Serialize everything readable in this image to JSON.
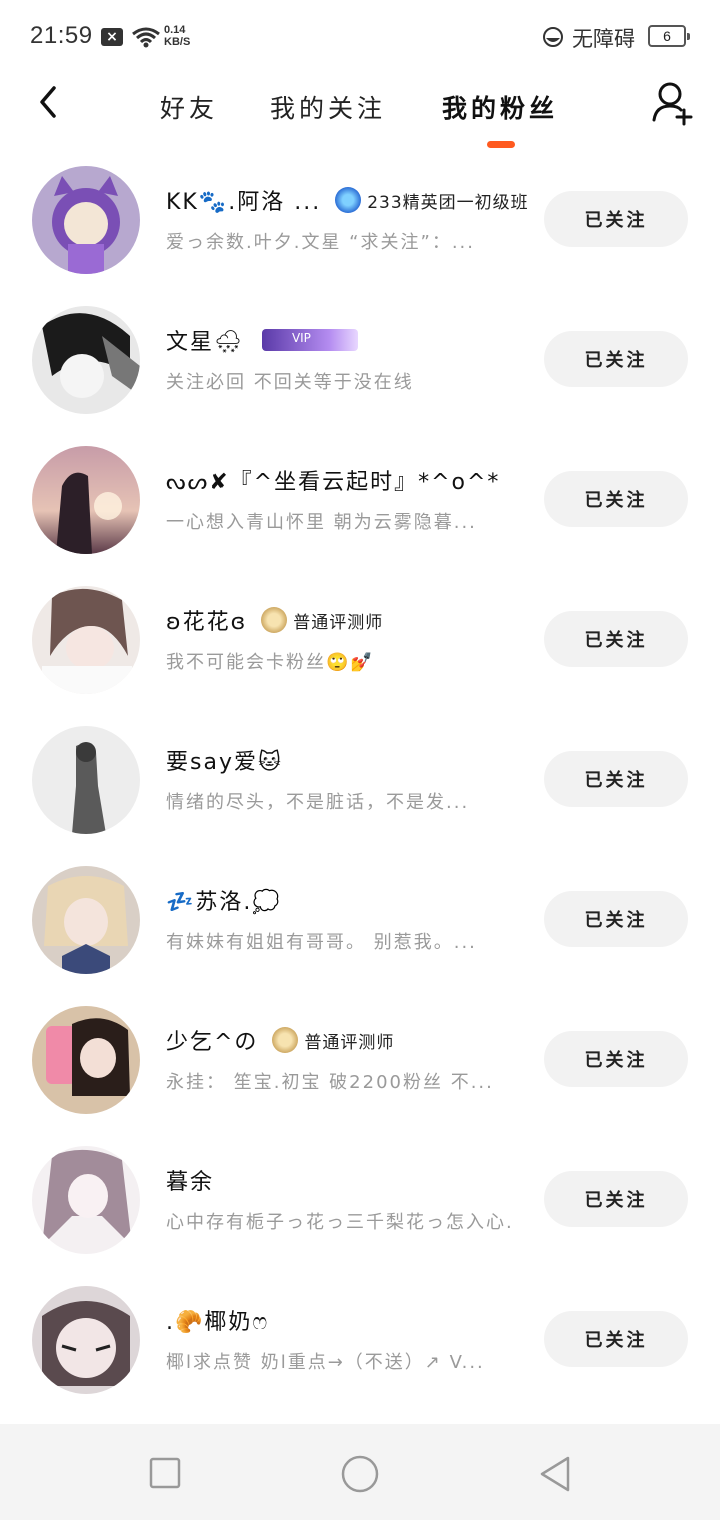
{
  "status_bar": {
    "time": "21:59",
    "speed_value": "0.14",
    "speed_unit": "KB/S",
    "accessibility": "无障碍",
    "battery": "6"
  },
  "nav": {
    "tabs": [
      {
        "label": "好友",
        "active": false
      },
      {
        "label": "我的关注",
        "active": false
      },
      {
        "label": "我的粉丝",
        "active": true
      }
    ],
    "accent_color": "#ff5a1f"
  },
  "follow_label": "已关注",
  "fans": [
    {
      "name": "KK🐾.阿洛 ...",
      "badge": "233精英团一初级班",
      "bio": "爱っ余数.叶夕.文星 “求关注”：..."
    },
    {
      "name": "文星🌨",
      "bio": "关注必回 不回关等于没在线"
    },
    {
      "name": "ᔓᔕ✘『^坐看云起时』*^o^*",
      "bio": "一心想入青山怀里 朝为云雾隐暮..."
    },
    {
      "name": "ʚ花花ɞ",
      "badge": "普通评测师",
      "bio": "我不可能会卡粉丝🙄💅"
    },
    {
      "name": "要say爱🐱",
      "bio": "情绪的尽头，不是脏话，不是发..."
    },
    {
      "name": "💤苏洛.💭",
      "bio": "有妹妹有姐姐有哥哥。 别惹我。..."
    },
    {
      "name": "少乞^の",
      "badge": "普通评测师",
      "bio": "永挂： 笙宝.初宝 破2200粉丝 不..."
    },
    {
      "name": "暮余",
      "bio": "心中存有栀子っ花っ三千梨花っ怎入心."
    },
    {
      "name": ".🥐椰奶ෆ",
      "bio": "椰l求点赞 奶l重点→（不送）↗ V..."
    }
  ]
}
